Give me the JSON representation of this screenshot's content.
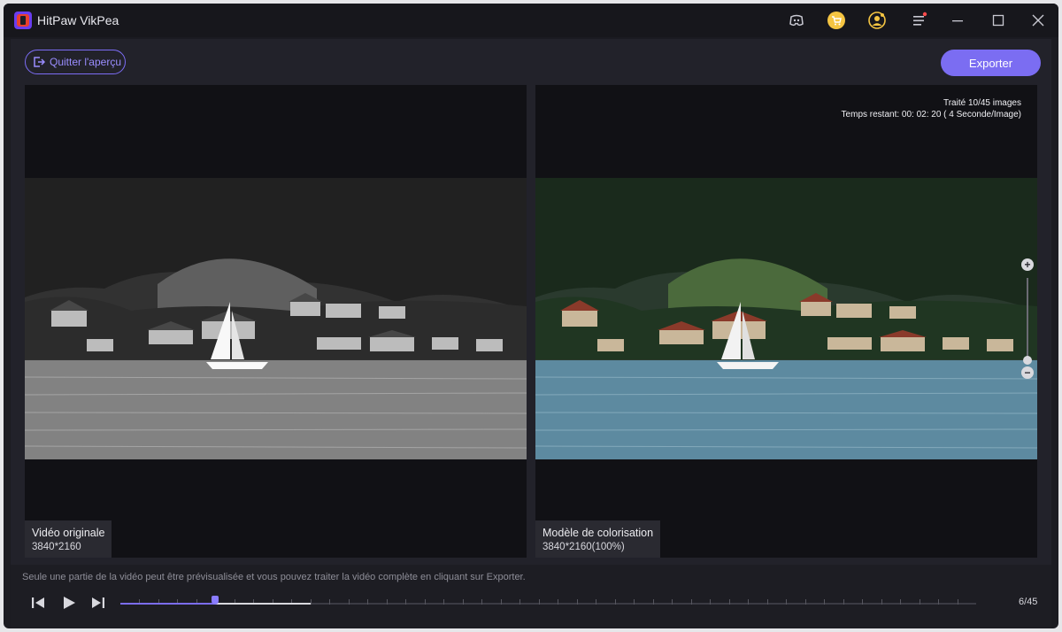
{
  "app": {
    "title": "HitPaw VikPea"
  },
  "toolbar": {
    "quit_label": "Quitter l'aperçu",
    "export_label": "Exporter"
  },
  "left_panel": {
    "title": "Vidéo originale",
    "resolution": "3840*2160"
  },
  "right_panel": {
    "title": "Modèle de colorisation",
    "resolution": "3840*2160(100%)",
    "processed_text": "Traité 10/45 images",
    "remaining_text": "Temps restant: 00: 02: 20 ( 4 Seconde/Image)"
  },
  "zoom": {
    "plus": "+",
    "minus": "−",
    "level": 0.1
  },
  "player": {
    "hint": "Seule une partie de la vidéo peut être prévisualisée et vous pouvez traiter la vidéo complète en cliquant sur Exporter.",
    "frame_counter": "6/45",
    "current_frame": 6,
    "buffered_frames": 10,
    "total_frames": 45
  },
  "colors": {
    "accent": "#7b6df2",
    "background": "#1b1b21",
    "panel": "#111115"
  },
  "icons": [
    "app-logo-icon",
    "discord-icon",
    "cart-icon",
    "user-icon",
    "menu-icon",
    "minimize-icon",
    "maximize-icon",
    "close-icon",
    "exit-icon",
    "previous-frame-icon",
    "play-icon",
    "next-frame-icon"
  ]
}
